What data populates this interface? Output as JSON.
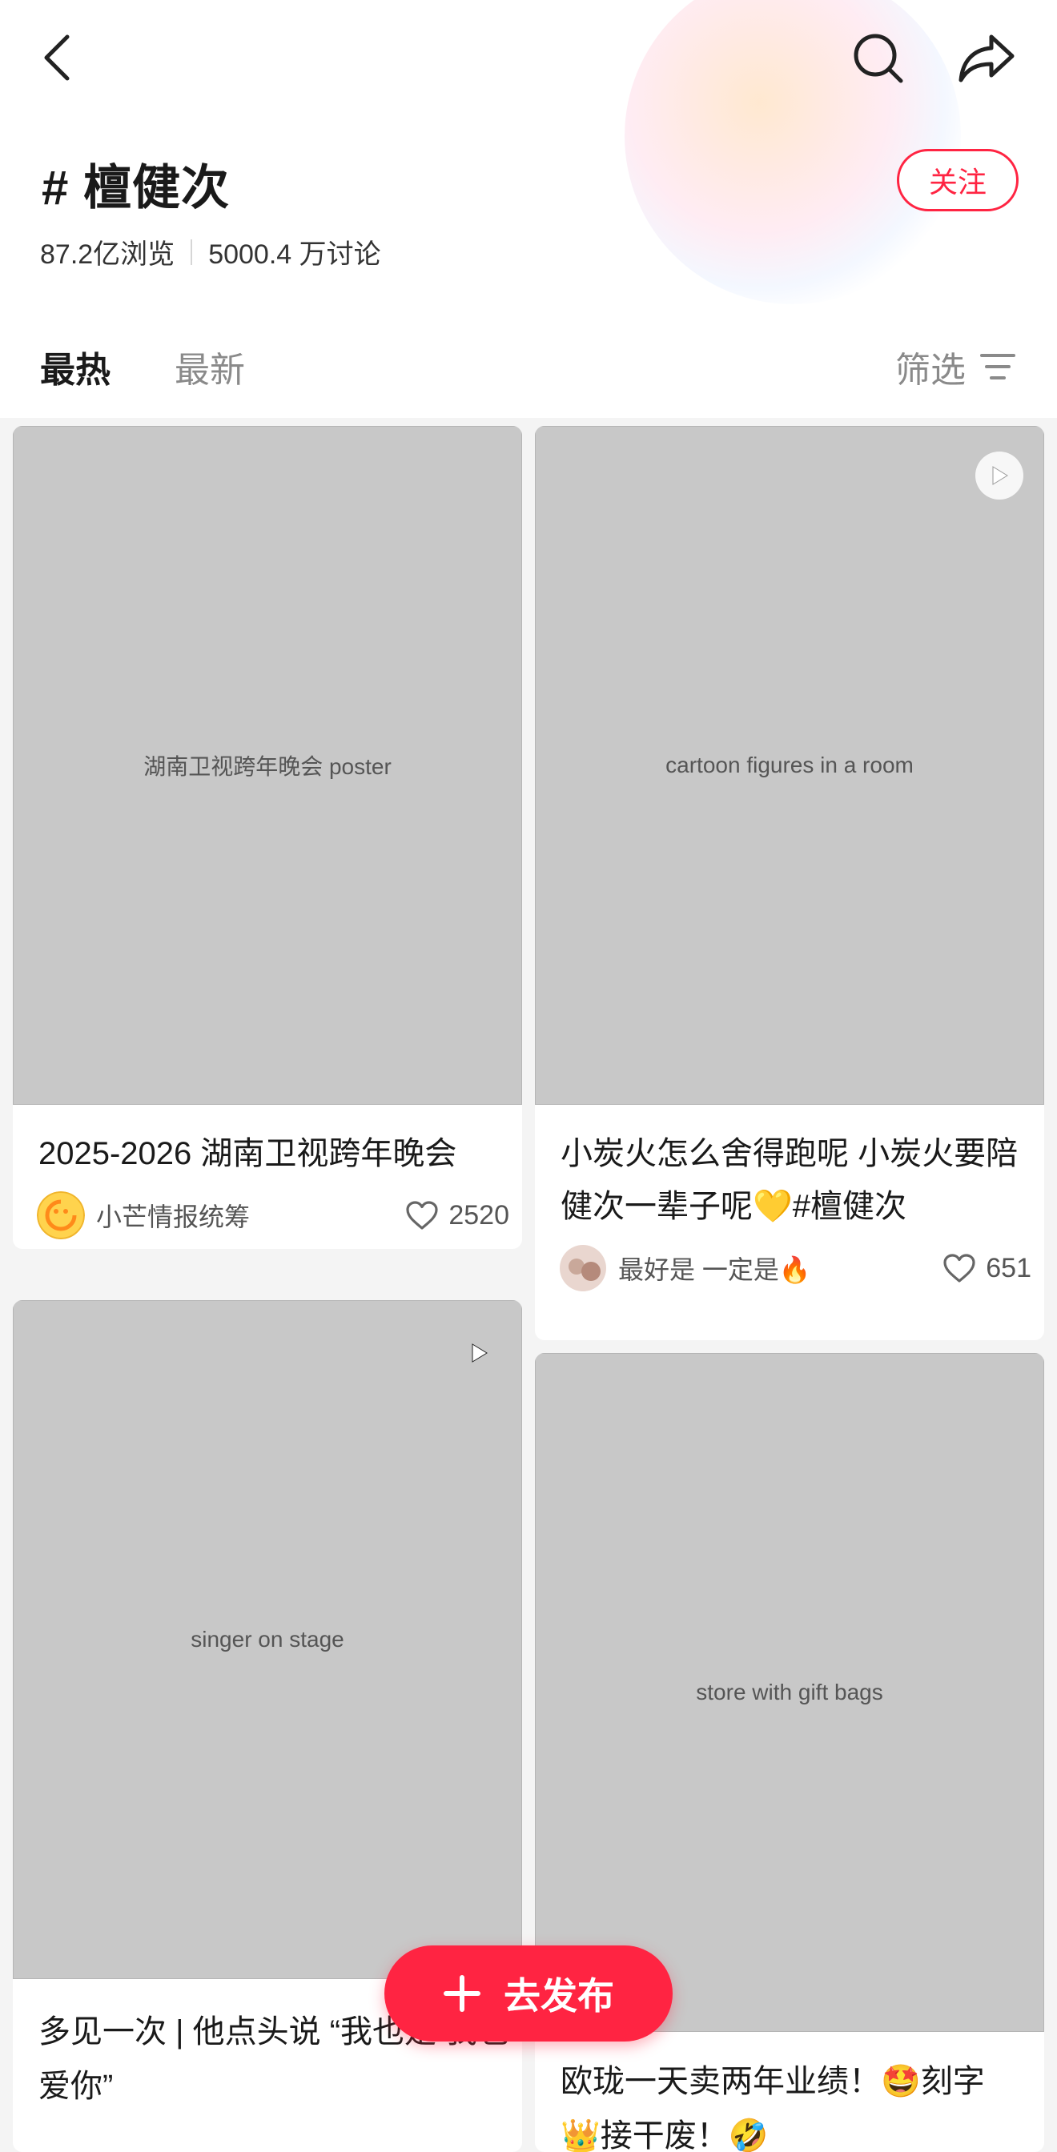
{
  "header": {
    "topic_title": "# 檀健次",
    "views": "87.2亿浏览",
    "discussions": "5000.4 万讨论",
    "follow_label": "关注",
    "icons": {
      "back": "back-arrow-icon",
      "search": "search-icon",
      "share": "share-icon"
    }
  },
  "tabs": {
    "hot": "最热",
    "new": "最新",
    "filter": "筛选"
  },
  "feed": [
    {
      "image_alt": "湖南卫视跨年晚会 poster",
      "title": "2025-2026 湖南卫视跨年晚会",
      "author": "小芒情报统筹",
      "likes": "2520"
    },
    {
      "image_alt": "cartoon figures in a room",
      "title": "小炭火怎么舍得跑呢 小炭火要陪健次一辈子呢💛#檀健次",
      "author": "最好是 一定是🔥",
      "likes": "651"
    },
    {
      "image_alt": "singer on stage",
      "title": "多见一次 | 他点头说 “我也是 我也爱你”"
    },
    {
      "image_alt": "store with gift bags",
      "title": "欧珑一天卖两年业绩！🤩刻字 👑接干废！🤣"
    }
  ],
  "post_button": {
    "label": "去发布"
  },
  "colors": {
    "accent": "#ff2442"
  }
}
